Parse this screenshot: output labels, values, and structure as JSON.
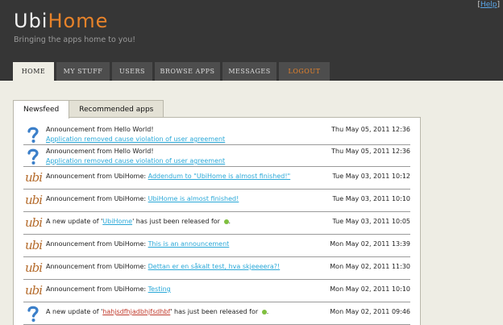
{
  "header": {
    "logo_part1": "Ubi",
    "logo_part2": "Home",
    "tagline": "Bringing the apps home to you!",
    "help_bracket_open": "[",
    "help_label": "Help",
    "help_bracket_close": "]"
  },
  "nav": [
    {
      "label": "HOME"
    },
    {
      "label": "MY STUFF"
    },
    {
      "label": "USERS"
    },
    {
      "label": "BROWSE APPS"
    },
    {
      "label": "MESSAGES"
    },
    {
      "label": "LOGOUT"
    }
  ],
  "subtabs": [
    {
      "label": "Newsfeed"
    },
    {
      "label": "Recommended apps"
    }
  ],
  "feed": [
    {
      "icon": "question-icon",
      "text": "Announcement from Hello World!",
      "link": "Application removed cause violation of user agreement",
      "date": "Thu May 05, 2011 12:36"
    },
    {
      "icon": "question-icon",
      "text": "Announcement from Hello World!",
      "link": "Application removed cause violation of user agreement",
      "date": "Thu May 05, 2011 12:36"
    },
    {
      "icon": "ubi-icon",
      "text": "Announcement from UbiHome: ",
      "link": "Addendum to \"UbiHome is almost finished!\"",
      "date": "Tue May 03, 2011 10:12"
    },
    {
      "icon": "ubi-icon",
      "text": "Announcement from UbiHome: ",
      "link": "UbiHome is almost finished!",
      "date": "Tue May 03, 2011 10:10"
    },
    {
      "icon": "ubi-icon",
      "pre": "A new update of '",
      "app": "UbiHome",
      "post": "' has just been released for",
      "date": "Tue May 03, 2011 10:05"
    },
    {
      "icon": "ubi-icon",
      "text": "Announcement from UbiHome: ",
      "link": "This is an announcement",
      "date": "Mon May 02, 2011 13:39"
    },
    {
      "icon": "ubi-icon",
      "text": "Announcement from UbiHome: ",
      "link": "Dettan er en såkalt test, hva skjeeeera?!",
      "date": "Mon May 02, 2011 11:30"
    },
    {
      "icon": "ubi-icon",
      "text": "Announcement from UbiHome: ",
      "link": "Testing",
      "date": "Mon May 02, 2011 10:10"
    },
    {
      "icon": "question-icon",
      "pre": "A new update of '",
      "app": "hahjsdfhjadbhjfsdhbf",
      "post": "' has just been released for",
      "date": "Mon May 02, 2011 09:46"
    }
  ],
  "colors": {
    "header_bg": "#363636",
    "accent_orange": "#e8832a",
    "link_blue": "#2aa8d8",
    "page_bg": "#eeede4"
  }
}
